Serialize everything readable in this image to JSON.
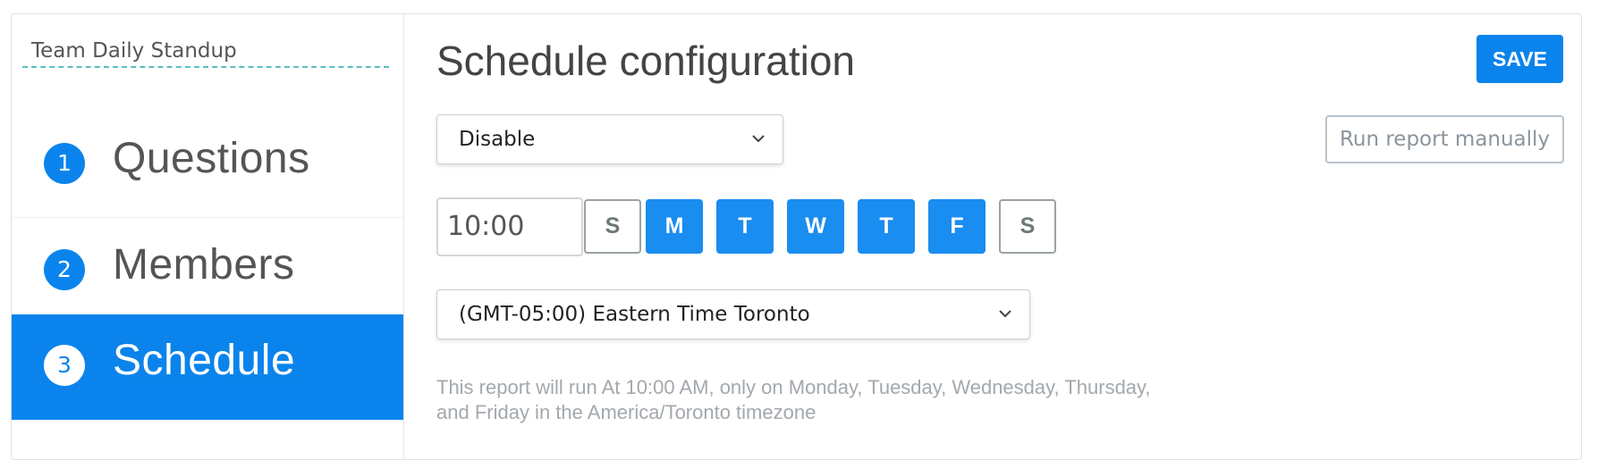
{
  "sidebar": {
    "project_title": "Team Daily Standup",
    "steps": [
      {
        "number": "1",
        "label": "Questions",
        "active": false
      },
      {
        "number": "2",
        "label": "Members",
        "active": false
      },
      {
        "number": "3",
        "label": "Schedule",
        "active": true
      }
    ]
  },
  "main": {
    "title": "Schedule configuration",
    "save_label": "SAVE",
    "status_select": {
      "value": "Disable"
    },
    "run_manual_label": "Run report manually",
    "time_input": {
      "value": "10:00"
    },
    "days": [
      {
        "letter": "S",
        "day": "Sunday",
        "selected": false
      },
      {
        "letter": "M",
        "day": "Monday",
        "selected": true
      },
      {
        "letter": "T",
        "day": "Tuesday",
        "selected": true
      },
      {
        "letter": "W",
        "day": "Wednesday",
        "selected": true
      },
      {
        "letter": "T",
        "day": "Thursday",
        "selected": true
      },
      {
        "letter": "F",
        "day": "Friday",
        "selected": true
      },
      {
        "letter": "S",
        "day": "Saturday",
        "selected": false
      }
    ],
    "timezone_select": {
      "value": "(GMT-05:00) Eastern Time Toronto"
    },
    "description_line1": "This report will run At 10:00 AM, only on Monday, Tuesday, Wednesday, Thursday,",
    "description_line2": "and Friday in the America/Toronto timezone"
  },
  "colors": {
    "accent": "#0a84ec",
    "day_selected": "#1a8df0",
    "title_underline": "#5bbfbf",
    "muted_text": "#a3a8ad"
  },
  "icons": {
    "select_arrow": "chevron-down-icon"
  }
}
